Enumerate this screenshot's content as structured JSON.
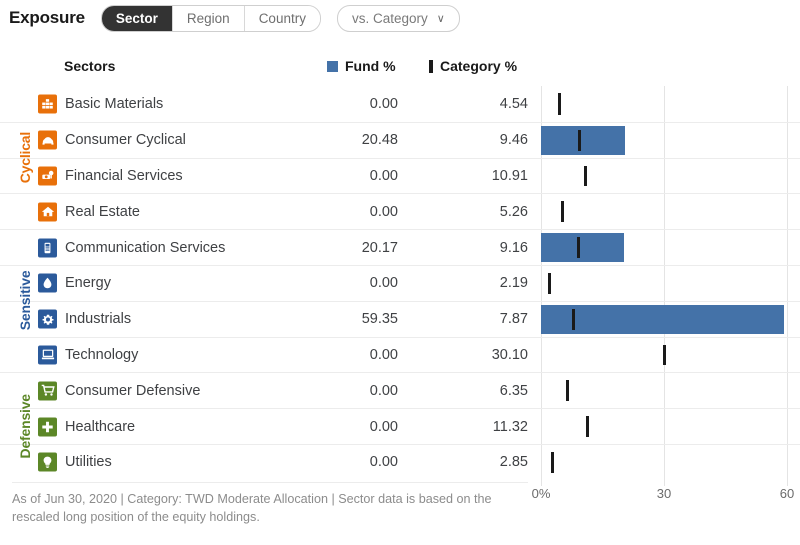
{
  "toolbar": {
    "title": "Exposure",
    "segments": [
      {
        "label": "Sector",
        "active": true
      },
      {
        "label": "Region",
        "active": false
      },
      {
        "label": "Country",
        "active": false
      }
    ],
    "dropdown": {
      "label": "vs. Category",
      "chevron": "∨"
    }
  },
  "table_header": {
    "sectors": "Sectors",
    "fund": "Fund  %",
    "category": "Category %"
  },
  "groups": [
    {
      "name": "Cyclical",
      "color": "#E8700A",
      "rows": 4
    },
    {
      "name": "Sensitive",
      "color": "#2B5A9B",
      "rows": 4
    },
    {
      "name": "Defensive",
      "color": "#5C8727",
      "rows": 3
    }
  ],
  "colors": {
    "fund_bar": "#4472a8",
    "category_marker": "#1a1a1a",
    "cyclical": "#E8700A",
    "sensitive": "#2B5A9B",
    "defensive": "#5C8727",
    "gridline": "#e4e4e4"
  },
  "rows": [
    {
      "sector": "Basic Materials",
      "icon": "blocks-icon",
      "group": "cyclical",
      "fund": "0.00",
      "category": "4.54"
    },
    {
      "sector": "Consumer Cyclical",
      "icon": "car-icon",
      "group": "cyclical",
      "fund": "20.48",
      "category": "9.46"
    },
    {
      "sector": "Financial Services",
      "icon": "bank-icon",
      "group": "cyclical",
      "fund": "0.00",
      "category": "10.91"
    },
    {
      "sector": "Real Estate",
      "icon": "house-icon",
      "group": "cyclical",
      "fund": "0.00",
      "category": "5.26"
    },
    {
      "sector": "Communication Services",
      "icon": "phone-icon",
      "group": "sensitive",
      "fund": "20.17",
      "category": "9.16"
    },
    {
      "sector": "Energy",
      "icon": "flame-icon",
      "group": "sensitive",
      "fund": "0.00",
      "category": "2.19"
    },
    {
      "sector": "Industrials",
      "icon": "gear-icon",
      "group": "sensitive",
      "fund": "59.35",
      "category": "7.87"
    },
    {
      "sector": "Technology",
      "icon": "computer-icon",
      "group": "sensitive",
      "fund": "0.00",
      "category": "30.10"
    },
    {
      "sector": "Consumer Defensive",
      "icon": "cart-icon",
      "group": "defensive",
      "fund": "0.00",
      "category": "6.35"
    },
    {
      "sector": "Healthcare",
      "icon": "cross-icon",
      "group": "defensive",
      "fund": "0.00",
      "category": "11.32"
    },
    {
      "sector": "Utilities",
      "icon": "bulb-icon",
      "group": "defensive",
      "fund": "0.00",
      "category": "2.85"
    }
  ],
  "chart_data": {
    "type": "bar",
    "title": "Exposure by Sector",
    "orientation": "horizontal",
    "categories": [
      "Basic Materials",
      "Consumer Cyclical",
      "Financial Services",
      "Real Estate",
      "Communication Services",
      "Energy",
      "Industrials",
      "Technology",
      "Consumer Defensive",
      "Healthcare",
      "Utilities"
    ],
    "series": [
      {
        "name": "Fund %",
        "values": [
          0.0,
          20.48,
          0.0,
          0.0,
          20.17,
          0.0,
          59.35,
          0.0,
          0.0,
          0.0,
          0.0
        ]
      },
      {
        "name": "Category %",
        "values": [
          4.54,
          9.46,
          10.91,
          5.26,
          9.16,
          2.19,
          7.87,
          30.1,
          6.35,
          11.32,
          2.85
        ]
      }
    ],
    "xlabel": "",
    "ylabel": "",
    "xlim": [
      0,
      60
    ],
    "xticks": [
      "0%",
      "30",
      "60"
    ],
    "xtick_values": [
      0,
      30,
      60
    ],
    "grid": true,
    "legend": [
      "Fund  %",
      "Category %"
    ]
  },
  "axis": {
    "ticks": [
      {
        "label": "0%",
        "value": 0
      },
      {
        "label": "30",
        "value": 30
      },
      {
        "label": "60",
        "value": 60
      }
    ]
  },
  "footnote": {
    "text": "As of Jun 30, 2020 | Category: TWD Moderate Allocation | Sector data is based on the rescaled long position of the equity holdings."
  }
}
